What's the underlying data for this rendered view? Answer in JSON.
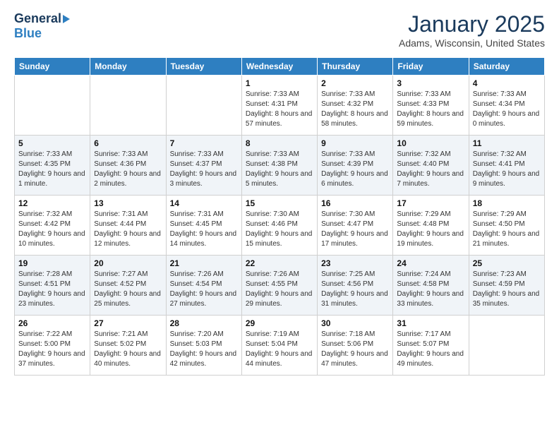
{
  "header": {
    "logo": {
      "general": "General",
      "blue": "Blue"
    },
    "title": "January 2025",
    "location": "Adams, Wisconsin, United States"
  },
  "weekdays": [
    "Sunday",
    "Monday",
    "Tuesday",
    "Wednesday",
    "Thursday",
    "Friday",
    "Saturday"
  ],
  "weeks": [
    [
      {
        "day": "",
        "sunrise": "",
        "sunset": "",
        "daylight": ""
      },
      {
        "day": "",
        "sunrise": "",
        "sunset": "",
        "daylight": ""
      },
      {
        "day": "",
        "sunrise": "",
        "sunset": "",
        "daylight": ""
      },
      {
        "day": "1",
        "sunrise": "Sunrise: 7:33 AM",
        "sunset": "Sunset: 4:31 PM",
        "daylight": "Daylight: 8 hours and 57 minutes."
      },
      {
        "day": "2",
        "sunrise": "Sunrise: 7:33 AM",
        "sunset": "Sunset: 4:32 PM",
        "daylight": "Daylight: 8 hours and 58 minutes."
      },
      {
        "day": "3",
        "sunrise": "Sunrise: 7:33 AM",
        "sunset": "Sunset: 4:33 PM",
        "daylight": "Daylight: 8 hours and 59 minutes."
      },
      {
        "day": "4",
        "sunrise": "Sunrise: 7:33 AM",
        "sunset": "Sunset: 4:34 PM",
        "daylight": "Daylight: 9 hours and 0 minutes."
      }
    ],
    [
      {
        "day": "5",
        "sunrise": "Sunrise: 7:33 AM",
        "sunset": "Sunset: 4:35 PM",
        "daylight": "Daylight: 9 hours and 1 minute."
      },
      {
        "day": "6",
        "sunrise": "Sunrise: 7:33 AM",
        "sunset": "Sunset: 4:36 PM",
        "daylight": "Daylight: 9 hours and 2 minutes."
      },
      {
        "day": "7",
        "sunrise": "Sunrise: 7:33 AM",
        "sunset": "Sunset: 4:37 PM",
        "daylight": "Daylight: 9 hours and 3 minutes."
      },
      {
        "day": "8",
        "sunrise": "Sunrise: 7:33 AM",
        "sunset": "Sunset: 4:38 PM",
        "daylight": "Daylight: 9 hours and 5 minutes."
      },
      {
        "day": "9",
        "sunrise": "Sunrise: 7:33 AM",
        "sunset": "Sunset: 4:39 PM",
        "daylight": "Daylight: 9 hours and 6 minutes."
      },
      {
        "day": "10",
        "sunrise": "Sunrise: 7:32 AM",
        "sunset": "Sunset: 4:40 PM",
        "daylight": "Daylight: 9 hours and 7 minutes."
      },
      {
        "day": "11",
        "sunrise": "Sunrise: 7:32 AM",
        "sunset": "Sunset: 4:41 PM",
        "daylight": "Daylight: 9 hours and 9 minutes."
      }
    ],
    [
      {
        "day": "12",
        "sunrise": "Sunrise: 7:32 AM",
        "sunset": "Sunset: 4:42 PM",
        "daylight": "Daylight: 9 hours and 10 minutes."
      },
      {
        "day": "13",
        "sunrise": "Sunrise: 7:31 AM",
        "sunset": "Sunset: 4:44 PM",
        "daylight": "Daylight: 9 hours and 12 minutes."
      },
      {
        "day": "14",
        "sunrise": "Sunrise: 7:31 AM",
        "sunset": "Sunset: 4:45 PM",
        "daylight": "Daylight: 9 hours and 14 minutes."
      },
      {
        "day": "15",
        "sunrise": "Sunrise: 7:30 AM",
        "sunset": "Sunset: 4:46 PM",
        "daylight": "Daylight: 9 hours and 15 minutes."
      },
      {
        "day": "16",
        "sunrise": "Sunrise: 7:30 AM",
        "sunset": "Sunset: 4:47 PM",
        "daylight": "Daylight: 9 hours and 17 minutes."
      },
      {
        "day": "17",
        "sunrise": "Sunrise: 7:29 AM",
        "sunset": "Sunset: 4:48 PM",
        "daylight": "Daylight: 9 hours and 19 minutes."
      },
      {
        "day": "18",
        "sunrise": "Sunrise: 7:29 AM",
        "sunset": "Sunset: 4:50 PM",
        "daylight": "Daylight: 9 hours and 21 minutes."
      }
    ],
    [
      {
        "day": "19",
        "sunrise": "Sunrise: 7:28 AM",
        "sunset": "Sunset: 4:51 PM",
        "daylight": "Daylight: 9 hours and 23 minutes."
      },
      {
        "day": "20",
        "sunrise": "Sunrise: 7:27 AM",
        "sunset": "Sunset: 4:52 PM",
        "daylight": "Daylight: 9 hours and 25 minutes."
      },
      {
        "day": "21",
        "sunrise": "Sunrise: 7:26 AM",
        "sunset": "Sunset: 4:54 PM",
        "daylight": "Daylight: 9 hours and 27 minutes."
      },
      {
        "day": "22",
        "sunrise": "Sunrise: 7:26 AM",
        "sunset": "Sunset: 4:55 PM",
        "daylight": "Daylight: 9 hours and 29 minutes."
      },
      {
        "day": "23",
        "sunrise": "Sunrise: 7:25 AM",
        "sunset": "Sunset: 4:56 PM",
        "daylight": "Daylight: 9 hours and 31 minutes."
      },
      {
        "day": "24",
        "sunrise": "Sunrise: 7:24 AM",
        "sunset": "Sunset: 4:58 PM",
        "daylight": "Daylight: 9 hours and 33 minutes."
      },
      {
        "day": "25",
        "sunrise": "Sunrise: 7:23 AM",
        "sunset": "Sunset: 4:59 PM",
        "daylight": "Daylight: 9 hours and 35 minutes."
      }
    ],
    [
      {
        "day": "26",
        "sunrise": "Sunrise: 7:22 AM",
        "sunset": "Sunset: 5:00 PM",
        "daylight": "Daylight: 9 hours and 37 minutes."
      },
      {
        "day": "27",
        "sunrise": "Sunrise: 7:21 AM",
        "sunset": "Sunset: 5:02 PM",
        "daylight": "Daylight: 9 hours and 40 minutes."
      },
      {
        "day": "28",
        "sunrise": "Sunrise: 7:20 AM",
        "sunset": "Sunset: 5:03 PM",
        "daylight": "Daylight: 9 hours and 42 minutes."
      },
      {
        "day": "29",
        "sunrise": "Sunrise: 7:19 AM",
        "sunset": "Sunset: 5:04 PM",
        "daylight": "Daylight: 9 hours and 44 minutes."
      },
      {
        "day": "30",
        "sunrise": "Sunrise: 7:18 AM",
        "sunset": "Sunset: 5:06 PM",
        "daylight": "Daylight: 9 hours and 47 minutes."
      },
      {
        "day": "31",
        "sunrise": "Sunrise: 7:17 AM",
        "sunset": "Sunset: 5:07 PM",
        "daylight": "Daylight: 9 hours and 49 minutes."
      },
      {
        "day": "",
        "sunrise": "",
        "sunset": "",
        "daylight": ""
      }
    ]
  ]
}
